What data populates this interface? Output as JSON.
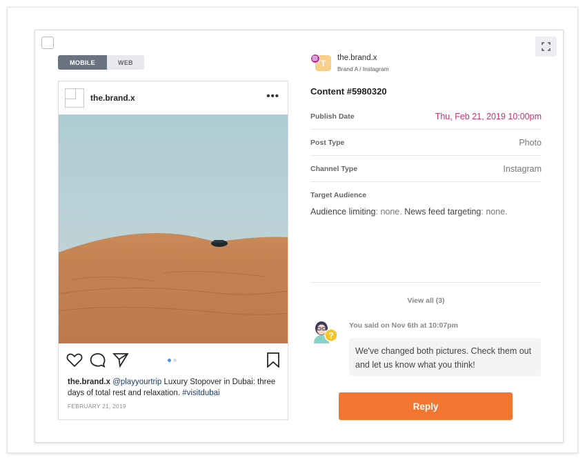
{
  "view_toggle": {
    "mobile": "MOBILE",
    "web": "WEB",
    "selected": "MOBILE"
  },
  "post": {
    "username": "the.brand.x",
    "more": "•••",
    "caption_user": "the.brand.x",
    "caption_mention": "@playyourtrip",
    "caption_text": " Luxury Stopover in Dubai: three days of total rest and relaxation. ",
    "caption_hashtag": "#visitdubai",
    "date": "FEBRUARY 21, 2019",
    "carousel_pages": 2,
    "carousel_active": 1
  },
  "brand": {
    "initial": "T",
    "name": "the.brand.x",
    "sub": "Brand A / Instagram"
  },
  "content": {
    "title": "Content #5980320",
    "rows": [
      {
        "label": "Publish Date",
        "value": "Thu, Feb 21, 2019 10:00pm"
      },
      {
        "label": "Post Type",
        "value": "Photo"
      },
      {
        "label": "Channel Type",
        "value": "Instagram"
      }
    ],
    "target_label": "Target Audience",
    "audience_limiting_label": "Audience limiting",
    "audience_limiting_value": ": none. ",
    "news_feed_label": "News feed targeting",
    "news_feed_value": ": none."
  },
  "comments": {
    "view_all": "View all (3)",
    "meta": "You said on Nov 6th at 10:07pm",
    "text": "We've changed both pictures. Check them out and let us know what you think!",
    "reply": "Reply"
  },
  "colors": {
    "accent": "#f27630",
    "publish_date": "#c8326d",
    "toggle_active": "#6b7280"
  }
}
